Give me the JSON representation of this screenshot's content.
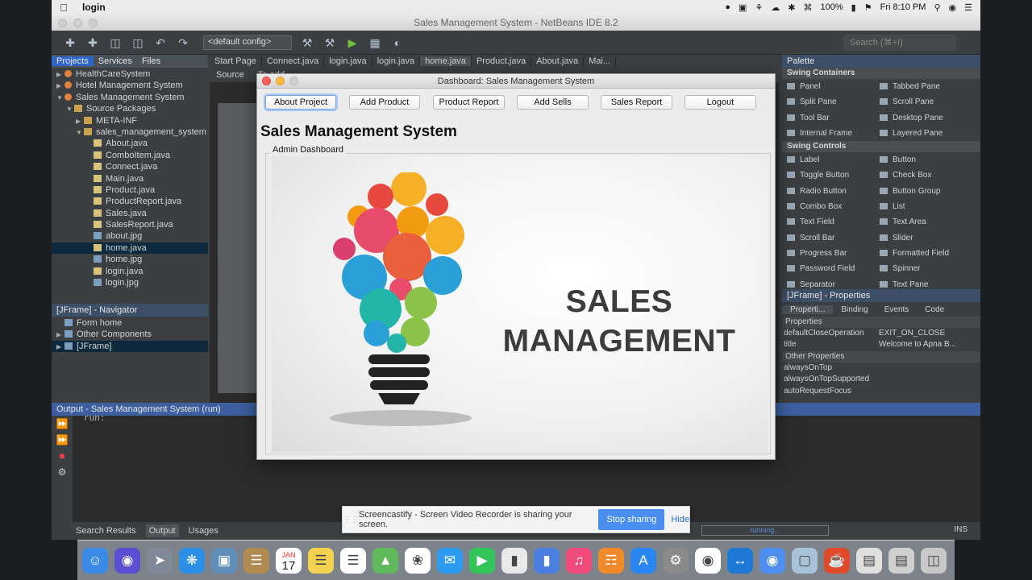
{
  "menubar": {
    "app_name": "login",
    "battery": "100%",
    "clock": "Fri 8:10 PM"
  },
  "ide": {
    "title": "Sales Management System - NetBeans IDE 8.2",
    "config": "<default config>",
    "search_placeholder": "Search (⌘+I)",
    "projects_panel": {
      "tabs": [
        "Projects",
        "Services",
        "Files"
      ],
      "tree": [
        {
          "label": "HealthCareSystem",
          "kind": "proj",
          "depth": 0,
          "arrow": "▶"
        },
        {
          "label": "Hotel Management System",
          "kind": "proj",
          "depth": 0,
          "arrow": "▶"
        },
        {
          "label": "Sales Management System",
          "kind": "proj",
          "depth": 0,
          "arrow": "▼"
        },
        {
          "label": "Source Packages",
          "kind": "pkg",
          "depth": 1,
          "arrow": "▼"
        },
        {
          "label": "META-INF",
          "kind": "pkg",
          "depth": 2,
          "arrow": "▶"
        },
        {
          "label": "sales_management_system",
          "kind": "pkg",
          "depth": 2,
          "arrow": "▼"
        },
        {
          "label": "About.java",
          "kind": "java",
          "depth": 3,
          "arrow": ""
        },
        {
          "label": "ComboItem.java",
          "kind": "java",
          "depth": 3,
          "arrow": ""
        },
        {
          "label": "Connect.java",
          "kind": "java",
          "depth": 3,
          "arrow": ""
        },
        {
          "label": "Main.java",
          "kind": "java",
          "depth": 3,
          "arrow": ""
        },
        {
          "label": "Product.java",
          "kind": "java",
          "depth": 3,
          "arrow": ""
        },
        {
          "label": "ProductReport.java",
          "kind": "java",
          "depth": 3,
          "arrow": ""
        },
        {
          "label": "Sales.java",
          "kind": "java",
          "depth": 3,
          "arrow": ""
        },
        {
          "label": "SalesReport.java",
          "kind": "java",
          "depth": 3,
          "arrow": ""
        },
        {
          "label": "about.jpg",
          "kind": "img",
          "depth": 3,
          "arrow": ""
        },
        {
          "label": "home.java",
          "kind": "java",
          "depth": 3,
          "arrow": "",
          "selected": true
        },
        {
          "label": "home.jpg",
          "kind": "img",
          "depth": 3,
          "arrow": ""
        },
        {
          "label": "login.java",
          "kind": "java",
          "depth": 3,
          "arrow": ""
        },
        {
          "label": "login.jpg",
          "kind": "img",
          "depth": 3,
          "arrow": ""
        }
      ]
    },
    "navigator": {
      "title": "[JFrame] - Navigator",
      "tree": [
        {
          "label": "Form home",
          "depth": 0,
          "arrow": ""
        },
        {
          "label": "Other Components",
          "depth": 1,
          "arrow": "▶"
        },
        {
          "label": "[JFrame]",
          "depth": 1,
          "arrow": "▶",
          "selected": true
        }
      ]
    },
    "editor_tabs": [
      "Start Page",
      "Connect.java",
      "login.java",
      "login.java",
      "home.java",
      "Product.java",
      "About.java",
      "Mai..."
    ],
    "editor_sub": {
      "source": "Source",
      "hint": "To add"
    },
    "palette": {
      "title": "Palette",
      "categories": [
        {
          "name": "Swing Containers",
          "items": [
            "Panel",
            "Tabbed Pane",
            "Split Pane",
            "Scroll Pane",
            "Tool Bar",
            "Desktop Pane",
            "Internal Frame",
            "Layered Pane"
          ]
        },
        {
          "name": "Swing Controls",
          "items": [
            "Label",
            "Button",
            "Toggle Button",
            "Check Box",
            "Radio Button",
            "Button Group",
            "Combo Box",
            "List",
            "Text Field",
            "Text Area",
            "Scroll Bar",
            "Slider",
            "Progress Bar",
            "Formatted Field",
            "Password Field",
            "Spinner",
            "Separator",
            "Text Pane"
          ]
        }
      ]
    },
    "properties": {
      "title": "[JFrame] - Properties",
      "tabs": [
        "Properti...",
        "Binding",
        "Events",
        "Code"
      ],
      "sections": [
        {
          "name": "Properties",
          "rows": [
            {
              "key": "defaultCloseOperation",
              "value": "EXIT_ON_CLOSE"
            },
            {
              "key": "title",
              "value": "Welcome to Apna B..."
            }
          ]
        },
        {
          "name": "Other Properties",
          "rows": [
            {
              "key": "alwaysOnTop",
              "value": ""
            },
            {
              "key": "alwaysOnTopSupported",
              "value": ""
            },
            {
              "key": "autoRequestFocus",
              "value": ""
            }
          ]
        }
      ]
    },
    "output": {
      "title": "Output - Sales Management System (run)",
      "text": "run:"
    },
    "statusbar": {
      "tabs": [
        "Search Results",
        "Output",
        "Usages"
      ],
      "running": "running...",
      "mode": "INS"
    }
  },
  "app": {
    "title": "Dashboard: Sales Management System",
    "buttons": [
      "About Project",
      "Add Product",
      "Product Report",
      "Add Sells",
      "Sales Report",
      "Logout"
    ],
    "heading": "Sales Management System",
    "frame_label": "Admin Dashboard",
    "banner_line1": "SALES",
    "banner_line2": "MANAGEMENT"
  },
  "screencastify": {
    "message": "Screencastify - Screen Video Recorder is sharing your screen.",
    "stop_label": "Stop sharing",
    "hide_label": "Hide"
  },
  "dock": {
    "calendar_month": "JAN",
    "calendar_day": "17",
    "icons": [
      "finder-icon",
      "siri-icon",
      "launchpad-icon",
      "safari-icon",
      "preview-icon",
      "notes-book-icon",
      "calendar-icon",
      "stickies-icon",
      "reminders-icon",
      "maps-icon",
      "photos-icon",
      "messages-icon",
      "facetime-icon",
      "keynote-icon",
      "presentation-icon",
      "itunes-icon",
      "ibooks-icon",
      "app-store-icon",
      "system-preferences-icon",
      "chrome-icon",
      "teamviewer-icon",
      "chromium-icon",
      "virtualbox-icon",
      "java-icon",
      "documents-icon",
      "downloads-icon",
      "trash-icon"
    ]
  }
}
